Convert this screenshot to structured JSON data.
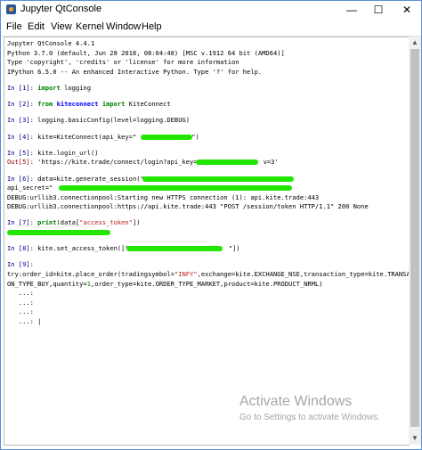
{
  "window": {
    "title": "Jupyter QtConsole",
    "controls": {
      "minimize": "—",
      "maximize": "☐",
      "close": "✕"
    }
  },
  "menu": [
    "File",
    "Edit",
    "View",
    "Kernel",
    "Window",
    "Help"
  ],
  "console": {
    "banner": [
      "Jupyter QtConsole 4.4.1",
      "Python 3.7.0 (default, Jun 28 2018, 08:04:48) [MSC v.1912 64 bit (AMD64)]",
      "Type 'copyright', 'credits' or 'license' for more information",
      "IPython 6.5.0 -- An enhanced Interactive Python. Type '?' for help."
    ],
    "cells": {
      "c1": {
        "prompt": "In [1]:",
        "kw": "import",
        "rest": " logging"
      },
      "c2": {
        "prompt": "In [2]:",
        "kw1": "from",
        "mod": "kiteconnect",
        "kw2": "import",
        "rest": " KiteConnect"
      },
      "c3": {
        "prompt": "In [3]:",
        "code": " logging.basicConfig(level=logging.DEBUG)"
      },
      "c4": {
        "prompt": "In [4]:",
        "code": " kite=KiteConnect(api_key=\"",
        "end": "\")"
      },
      "c5": {
        "prompt": "In [5]:",
        "code": " kite.login_url()"
      },
      "o5": {
        "prompt": "Out[5]:",
        "str": " 'https://kite.trade/connect/login?api_key=",
        "end": "v=3'"
      },
      "c6": {
        "prompt": "In [6]:",
        "code": " data=kite.generate_session(\"",
        "line2": "api_secret=\"",
        "debug1": "DEBUG:urllib3.connectionpool:Starting new HTTPS connection (1): api.kite.trade:443",
        "debug2": "DEBUG:urllib3.connectionpool:https://api.kite.trade:443 \"POST /session/token HTTP/1.1\" 200 None"
      },
      "c7": {
        "prompt": "In [7]:",
        "func": " print",
        "open": "(data[",
        "str": "\"access_token\"",
        "close": "])"
      },
      "c8": {
        "prompt": "In [8]:",
        "code": " kite.set_access_token([\"",
        "end": "\"])"
      },
      "c9": {
        "prompt": "In [9]:",
        "line1_a": "try:order_id=kite.place_order(tradingsymbol=",
        "line1_str": "\"INFY\"",
        "line1_b": ",exchange=kite.EXCHANGE_NSE,transaction_type=kite.TRANSACTI",
        "line2_a": "ON_TYPE_BUY,quantity=",
        "line2_num": "1",
        "line2_b": ",order_type=kite.ORDER_TYPE_MARKET,product=kite.PRODUCT_NRML)",
        "continuation": "   ...:",
        "last": "   ...: |"
      }
    }
  },
  "watermark": {
    "title": "Activate Windows",
    "subtitle": "Go to Settings to activate Windows."
  }
}
